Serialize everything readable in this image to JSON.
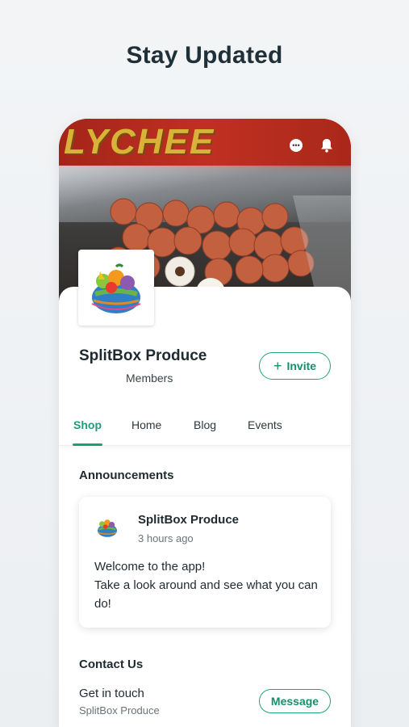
{
  "headline": "Stay Updated",
  "cover": {
    "brand_text": "LYCHEE",
    "chat_icon": "chat-bubble-icon",
    "bell_icon": "bell-icon"
  },
  "group": {
    "name": "SplitBox Produce",
    "members_label": "Members",
    "invite_label": "Invite",
    "invite_icon": "+"
  },
  "tabs": [
    {
      "label": "Shop",
      "active": true
    },
    {
      "label": "Home",
      "active": false
    },
    {
      "label": "Blog",
      "active": false
    },
    {
      "label": "Events",
      "active": false
    }
  ],
  "announcements": {
    "title": "Announcements",
    "post": {
      "author": "SplitBox Produce",
      "time": "3 hours ago",
      "line1": "Welcome to the app!",
      "line2": "Take a look around and see what you can do!"
    }
  },
  "contact": {
    "title": "Contact Us",
    "subtitle": "Get in touch",
    "name": "SplitBox Produce",
    "message_label": "Message"
  },
  "colors": {
    "accent": "#1aa078",
    "text": "#1f2a30"
  }
}
